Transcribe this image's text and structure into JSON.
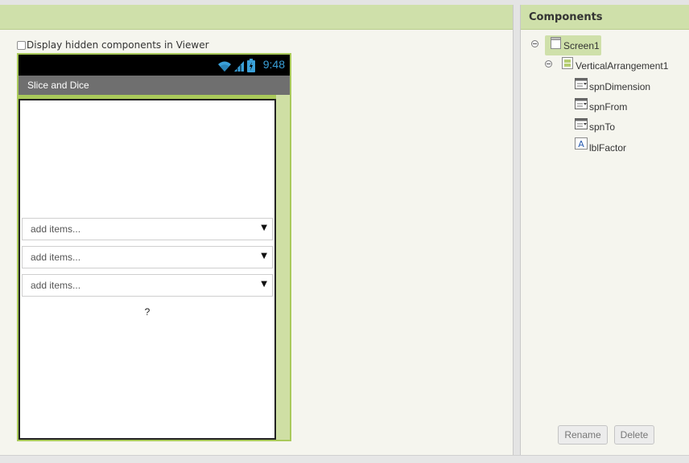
{
  "viewer": {
    "hidden_components_label": "Display hidden components in Viewer",
    "phone": {
      "time": "9:48",
      "app_title": "Slice and Dice",
      "spinners": [
        {
          "placeholder": "add items...",
          "arrow": "▼"
        },
        {
          "placeholder": "add items...",
          "arrow": "▼"
        },
        {
          "placeholder": "add items...",
          "arrow": "▼"
        }
      ],
      "label_text": "?"
    }
  },
  "components": {
    "title": "Components",
    "tree": {
      "screen": "Screen1",
      "arrangement": "VerticalArrangement1",
      "children": [
        "spnDimension",
        "spnFrom",
        "spnTo",
        "lblFactor"
      ]
    },
    "rename_label": "Rename",
    "delete_label": "Delete"
  },
  "colors": {
    "header_green": "#cfe0aa",
    "phone_frame": "#a9c95a",
    "clock_blue": "#3aa0d8"
  }
}
